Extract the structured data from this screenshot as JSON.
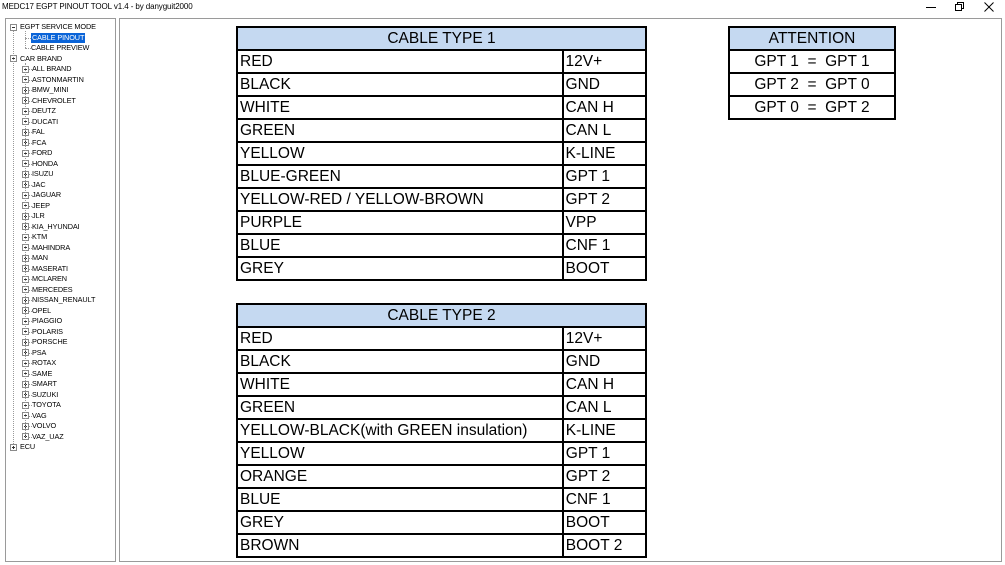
{
  "window": {
    "title": "MEDC17 EGPT PINOUT TOOL v1.4 - by danyguit2000"
  },
  "tree": {
    "service_mode": {
      "label": "EGPT SERVICE MODE",
      "children": [
        "CABLE PINOUT",
        "CABLE PREVIEW"
      ],
      "selected": "CABLE PINOUT"
    },
    "car_brand": {
      "label": "CAR BRAND",
      "children": [
        "ALL BRAND",
        "ASTONMARTIN",
        "BMW_MINI",
        "CHEVROLET",
        "DEUTZ",
        "DUCATI",
        "FAL",
        "FCA",
        "FORD",
        "HONDA",
        "ISUZU",
        "JAC",
        "JAGUAR",
        "JEEP",
        "JLR",
        "KIA_HYUNDAI",
        "KTM",
        "MAHINDRA",
        "MAN",
        "MASERATI",
        "MCLAREN",
        "MERCEDES",
        "NISSAN_RENAULT",
        "OPEL",
        "PIAGGIO",
        "POLARIS",
        "PORSCHE",
        "PSA",
        "ROTAX",
        "SAME",
        "SMART",
        "SUZUKI",
        "TOYOTA",
        "VAG",
        "VOLVO",
        "VAZ_UAZ"
      ]
    },
    "ecu": {
      "label": "ECU"
    }
  },
  "cable_type_1": {
    "title": "CABLE TYPE 1",
    "rows": [
      [
        "RED",
        "12V+"
      ],
      [
        "BLACK",
        "GND"
      ],
      [
        "WHITE",
        "CAN H"
      ],
      [
        "GREEN",
        "CAN L"
      ],
      [
        "YELLOW",
        "K-LINE"
      ],
      [
        "BLUE-GREEN",
        "GPT 1"
      ],
      [
        "YELLOW-RED / YELLOW-BROWN",
        "GPT 2"
      ],
      [
        "PURPLE",
        "VPP"
      ],
      [
        "BLUE",
        "CNF 1"
      ],
      [
        "GREY",
        "BOOT"
      ]
    ]
  },
  "cable_type_2": {
    "title": "CABLE TYPE 2",
    "rows": [
      [
        "RED",
        "12V+"
      ],
      [
        "BLACK",
        "GND"
      ],
      [
        "WHITE",
        "CAN H"
      ],
      [
        "GREEN",
        "CAN L"
      ],
      [
        "YELLOW-BLACK(with GREEN insulation)",
        "K-LINE"
      ],
      [
        "YELLOW",
        "GPT 1"
      ],
      [
        "ORANGE",
        "GPT 2"
      ],
      [
        "BLUE",
        "CNF 1"
      ],
      [
        "GREY",
        "BOOT"
      ],
      [
        "BROWN",
        "BOOT 2"
      ]
    ]
  },
  "attention": {
    "title": "ATTENTION",
    "rows": [
      "GPT 1  =  GPT 1",
      "GPT 2  =  GPT 0",
      "GPT 0  =  GPT 2"
    ]
  },
  "colors": {
    "header_fill": "#c5d9f1",
    "selection": "#0a64d8"
  }
}
